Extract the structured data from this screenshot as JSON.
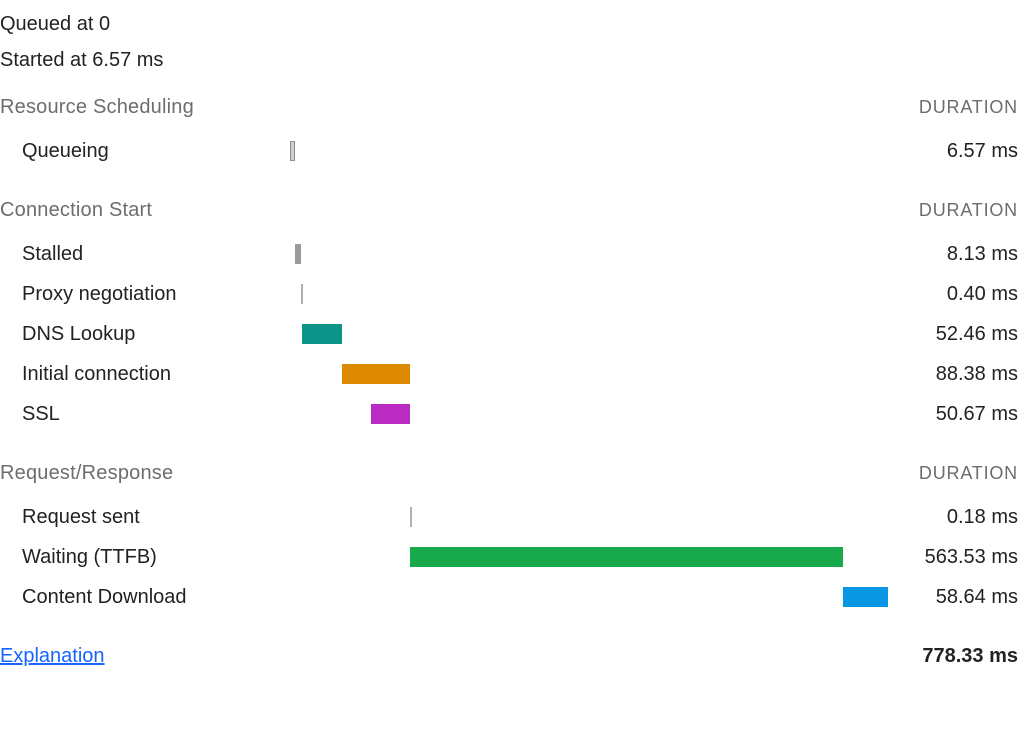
{
  "header": {
    "queued_line_prefix": "Queued at ",
    "queued_value": "0",
    "started_line_prefix": "Started at ",
    "started_value": "6.57 ms"
  },
  "duration_header_label": "DURATION",
  "sections": [
    {
      "title": "Resource Scheduling"
    },
    {
      "title": "Connection Start"
    },
    {
      "title": "Request/Response"
    }
  ],
  "chart_data": {
    "type": "bar",
    "xlabel": "",
    "ylabel": "",
    "title": "",
    "x_unit": "ms",
    "xlim": [
      0,
      778.33
    ],
    "series": [
      {
        "section": 0,
        "name": "Queueing",
        "start": 0,
        "duration": 6.57,
        "duration_label": "6.57 ms",
        "color": "#cfcfcf",
        "border": "#8e8e8e"
      },
      {
        "section": 1,
        "name": "Stalled",
        "start": 6.57,
        "duration": 8.13,
        "duration_label": "8.13 ms",
        "color": "#9a9a9a",
        "border": ""
      },
      {
        "section": 1,
        "name": "Proxy negotiation",
        "start": 14.7,
        "duration": 0.4,
        "duration_label": "0.40 ms",
        "color": "#b0b0b0",
        "border": ""
      },
      {
        "section": 1,
        "name": "DNS Lookup",
        "start": 15.1,
        "duration": 52.46,
        "duration_label": "52.46 ms",
        "color": "#0d9488",
        "border": ""
      },
      {
        "section": 1,
        "name": "Initial connection",
        "start": 67.56,
        "duration": 88.38,
        "duration_label": "88.38 ms",
        "color": "#dd8a00",
        "border": ""
      },
      {
        "section": 1,
        "name": "SSL",
        "start": 105.27,
        "duration": 50.67,
        "duration_label": "50.67 ms",
        "color": "#b92bc3",
        "border": ""
      },
      {
        "section": 2,
        "name": "Request sent",
        "start": 155.94,
        "duration": 0.18,
        "duration_label": "0.18 ms",
        "color": "#b0b0b0",
        "border": ""
      },
      {
        "section": 2,
        "name": "Waiting (TTFB)",
        "start": 156.12,
        "duration": 563.53,
        "duration_label": "563.53 ms",
        "color": "#18a94c",
        "border": ""
      },
      {
        "section": 2,
        "name": "Content Download",
        "start": 719.65,
        "duration": 58.64,
        "duration_label": "58.64 ms",
        "color": "#0996e3",
        "border": ""
      }
    ]
  },
  "footer": {
    "explanation_label": "Explanation",
    "total_label": "778.33 ms"
  }
}
